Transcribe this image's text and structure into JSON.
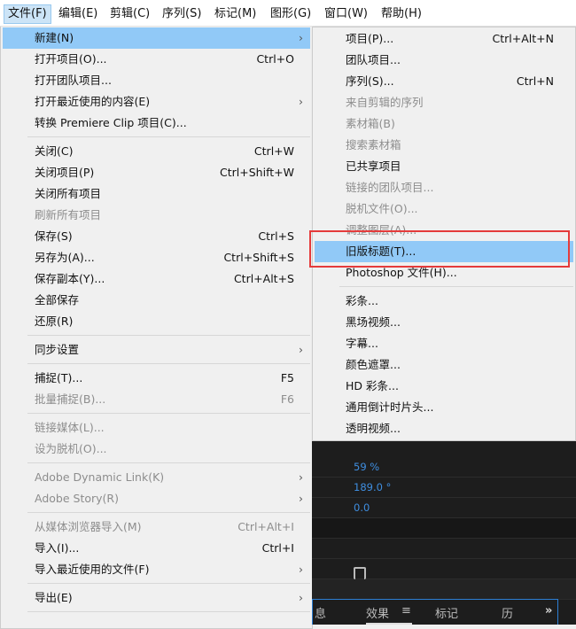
{
  "menubar": [
    "文件(F)",
    "编辑(E)",
    "剪辑(C)",
    "序列(S)",
    "标记(M)",
    "图形(G)",
    "窗口(W)",
    "帮助(H)"
  ],
  "file_menu": [
    {
      "label": "新建(N)",
      "arrow": true,
      "highlighted": true
    },
    {
      "label": "打开项目(O)...",
      "shortcut": "Ctrl+O"
    },
    {
      "label": "打开团队项目..."
    },
    {
      "label": "打开最近使用的内容(E)",
      "arrow": true
    },
    {
      "label": "转换 Premiere Clip 项目(C)..."
    },
    {
      "sep": true
    },
    {
      "label": "关闭(C)",
      "shortcut": "Ctrl+W"
    },
    {
      "label": "关闭项目(P)",
      "shortcut": "Ctrl+Shift+W"
    },
    {
      "label": "关闭所有项目"
    },
    {
      "label": "刷新所有项目",
      "disabled": true
    },
    {
      "label": "保存(S)",
      "shortcut": "Ctrl+S"
    },
    {
      "label": "另存为(A)...",
      "shortcut": "Ctrl+Shift+S"
    },
    {
      "label": "保存副本(Y)...",
      "shortcut": "Ctrl+Alt+S"
    },
    {
      "label": "全部保存"
    },
    {
      "label": "还原(R)"
    },
    {
      "sep": true
    },
    {
      "label": "同步设置",
      "arrow": true
    },
    {
      "sep": true
    },
    {
      "label": "捕捉(T)...",
      "shortcut": "F5"
    },
    {
      "label": "批量捕捉(B)...",
      "shortcut": "F6",
      "disabled": true
    },
    {
      "sep": true
    },
    {
      "label": "链接媒体(L)...",
      "disabled": true
    },
    {
      "label": "设为脱机(O)...",
      "disabled": true
    },
    {
      "sep": true
    },
    {
      "label": "Adobe Dynamic Link(K)",
      "arrow": true,
      "disabled": true
    },
    {
      "label": "Adobe Story(R)",
      "arrow": true,
      "disabled": true
    },
    {
      "sep": true
    },
    {
      "label": "从媒体浏览器导入(M)",
      "shortcut": "Ctrl+Alt+I",
      "disabled": true
    },
    {
      "label": "导入(I)...",
      "shortcut": "Ctrl+I"
    },
    {
      "label": "导入最近使用的文件(F)",
      "arrow": true
    },
    {
      "sep": true
    },
    {
      "label": "导出(E)",
      "arrow": true
    },
    {
      "sep": true
    }
  ],
  "new_submenu": [
    {
      "label": "项目(P)...",
      "shortcut": "Ctrl+Alt+N"
    },
    {
      "label": "团队项目..."
    },
    {
      "label": "序列(S)...",
      "shortcut": "Ctrl+N"
    },
    {
      "label": "来自剪辑的序列",
      "disabled": true
    },
    {
      "label": "素材箱(B)",
      "disabled": true
    },
    {
      "label": "搜索素材箱",
      "disabled": true
    },
    {
      "label": "已共享项目"
    },
    {
      "label": "链接的团队项目...",
      "disabled": true
    },
    {
      "label": "脱机文件(O)...",
      "disabled": true
    },
    {
      "label": "调整图层(A)...",
      "disabled": true
    },
    {
      "label": "旧版标题(T)...",
      "highlighted": true
    },
    {
      "label": "Photoshop 文件(H)..."
    },
    {
      "sep": true
    },
    {
      "label": "彩条..."
    },
    {
      "label": "黑场视频..."
    },
    {
      "label": "字幕..."
    },
    {
      "label": "颜色遮罩..."
    },
    {
      "label": "HD 彩条..."
    },
    {
      "label": "通用倒计时片头..."
    },
    {
      "label": "透明视频..."
    }
  ],
  "panel": {
    "values": [
      "59 %",
      "189.0 °",
      "0.0"
    ],
    "tabs": [
      "息",
      "效果",
      "≡",
      "标记",
      "历»"
    ],
    "tab_more": "»"
  },
  "colors": {
    "highlight": "#91c9f7",
    "annotation": "#e53b3b",
    "value": "#3f8ee0"
  }
}
